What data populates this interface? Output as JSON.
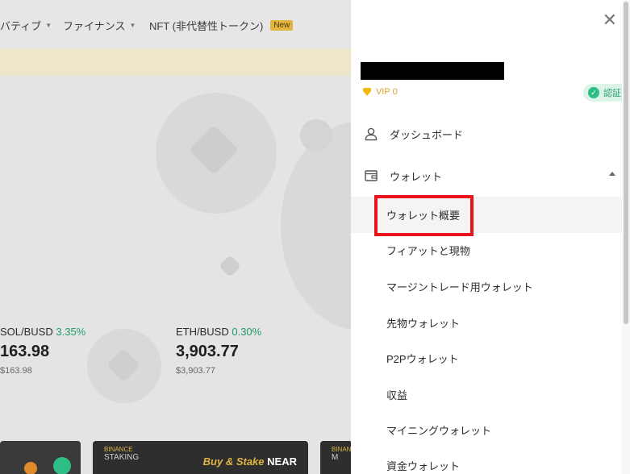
{
  "nav": {
    "items": [
      {
        "label": "バティブ",
        "caret": true
      },
      {
        "label": "ファイナンス",
        "caret": true
      },
      {
        "label": "NFT (非代替性トークン)",
        "badge": "New"
      }
    ]
  },
  "tickers": [
    {
      "pair": "SOL/BUSD",
      "change": "3.35%",
      "price": "163.98",
      "usd": "$163.98"
    },
    {
      "pair": "ETH/BUSD",
      "change": "0.30%",
      "price": "3,903.77",
      "usd": "$3,903.77"
    }
  ],
  "cards": [
    {
      "brand_top": "BINANCE",
      "brand_bottom": "STAKING",
      "headline": "Buy & Stake",
      "headline_bold": "NEAR"
    },
    {
      "brand_top": "BINANCE",
      "brand_bottom": "M"
    }
  ],
  "panel": {
    "close_icon": "close-icon",
    "vip_label": "VIP 0",
    "verify_label": "認証",
    "menu": [
      {
        "label": "ダッシュボード",
        "icon": "user-icon"
      },
      {
        "label": "ウォレット",
        "icon": "wallet-icon",
        "expanded": true
      }
    ],
    "wallet_items": [
      {
        "label": "ウォレット概要",
        "active": true
      },
      {
        "label": "フィアットと現物"
      },
      {
        "label": "マージントレード用ウォレット"
      },
      {
        "label": "先物ウォレット"
      },
      {
        "label": "P2Pウォレット"
      },
      {
        "label": "収益"
      },
      {
        "label": "マイニングウォレット"
      },
      {
        "label": "資金ウォレット"
      }
    ]
  },
  "colors": {
    "accent": "#f0b90b",
    "positive": "#1f9c6a",
    "highlight": "#e8141a"
  }
}
